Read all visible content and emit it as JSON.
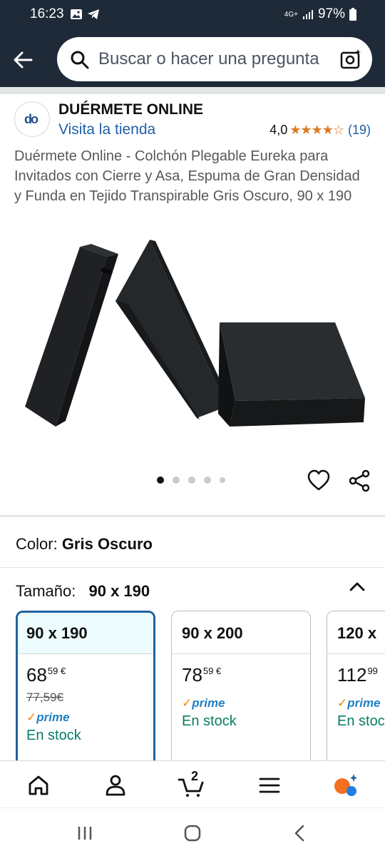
{
  "status_bar": {
    "time": "16:23",
    "network": "4G+",
    "battery": "97%"
  },
  "search": {
    "placeholder": "Buscar o hacer una pregunta"
  },
  "seller": {
    "logo_text": "do",
    "name": "DUÉRMETE ONLINE",
    "store_link": "Visita la tienda",
    "rating_value": "4,0",
    "rating_stars": 4.0,
    "rating_count": "(19)"
  },
  "product": {
    "title": "Duérmete Online - Colchón Plegable Eureka para Invitados con Cierre y Asa, Espuma de Gran Densidad y Funda en Tejido Transpirable Gris Oscuro, 90 x 190",
    "image_count": 5,
    "active_image": 1
  },
  "color": {
    "label": "Color:",
    "value": "Gris Oscuro"
  },
  "size": {
    "label": "Tamaño:",
    "value": "90 x 190",
    "options": [
      {
        "name": "90 x 190",
        "price_whole": "68",
        "price_fraction": "59",
        "currency": "€",
        "old_price": "77,59€",
        "prime": "prime",
        "stock": "En stock",
        "selected": true
      },
      {
        "name": "90 x 200",
        "price_whole": "78",
        "price_fraction": "59",
        "currency": "€",
        "prime": "prime",
        "stock": "En stock",
        "selected": false
      },
      {
        "name": "120 x",
        "price_whole": "112",
        "price_fraction": "99",
        "currency": "",
        "prime": "prime",
        "stock": "En stoc",
        "selected": false
      }
    ]
  },
  "bottom_nav": {
    "cart_count": "2",
    "items": [
      "home-icon",
      "account-icon",
      "cart-icon",
      "menu-icon",
      "rufus-icon"
    ]
  },
  "colors": {
    "header_bg": "#1e2a38",
    "link": "#1f5fa8",
    "star": "#de7921",
    "stock_green": "#067d62",
    "selected_border": "#2162a1"
  }
}
